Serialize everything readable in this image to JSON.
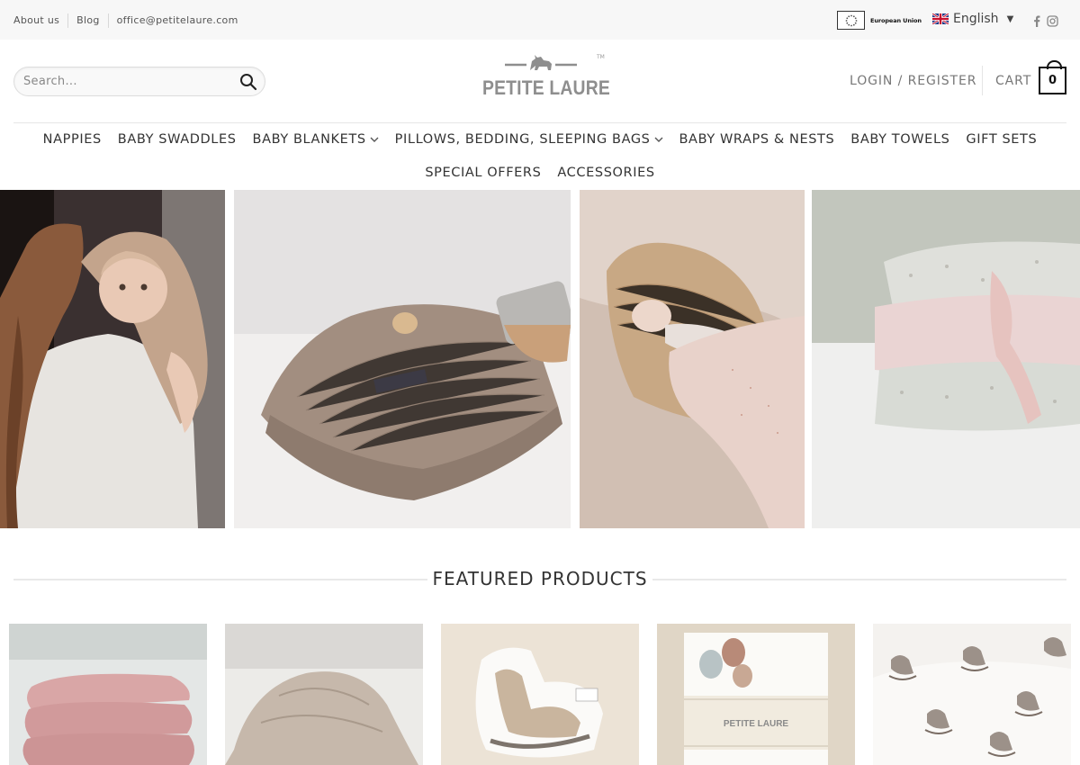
{
  "topbar": {
    "links": [
      "About us",
      "Blog",
      "office@petitelaure.com"
    ],
    "eu_label": "European Union",
    "language": "English",
    "social": [
      "facebook-icon",
      "instagram-icon"
    ]
  },
  "header": {
    "search_placeholder": "Search...",
    "logo_text": "PETITE LAURE",
    "logo_tm": "TM",
    "login_label": "LOGIN / REGISTER",
    "cart_label": "CART",
    "cart_count": "0"
  },
  "nav": {
    "row1": [
      {
        "label": "NAPPIES",
        "dropdown": false
      },
      {
        "label": "BABY SWADDLES",
        "dropdown": false
      },
      {
        "label": "BABY BLANKETS",
        "dropdown": true
      },
      {
        "label": "PILLOWS, BEDDING, SLEEPING BAGS",
        "dropdown": true
      },
      {
        "label": "BABY WRAPS & NESTS",
        "dropdown": false
      },
      {
        "label": "BABY TOWELS",
        "dropdown": false
      },
      {
        "label": "GIFT SETS",
        "dropdown": false
      }
    ],
    "row2": [
      {
        "label": "SPECIAL OFFERS",
        "dropdown": false
      },
      {
        "label": "ACCESSORIES",
        "dropdown": false
      }
    ]
  },
  "featured": {
    "title": "FEATURED PRODUCTS"
  },
  "colors": {
    "topbar_bg": "#f7f7f7",
    "text": "#333333",
    "muted": "#777777",
    "logo_grey": "#8e8e8e"
  }
}
